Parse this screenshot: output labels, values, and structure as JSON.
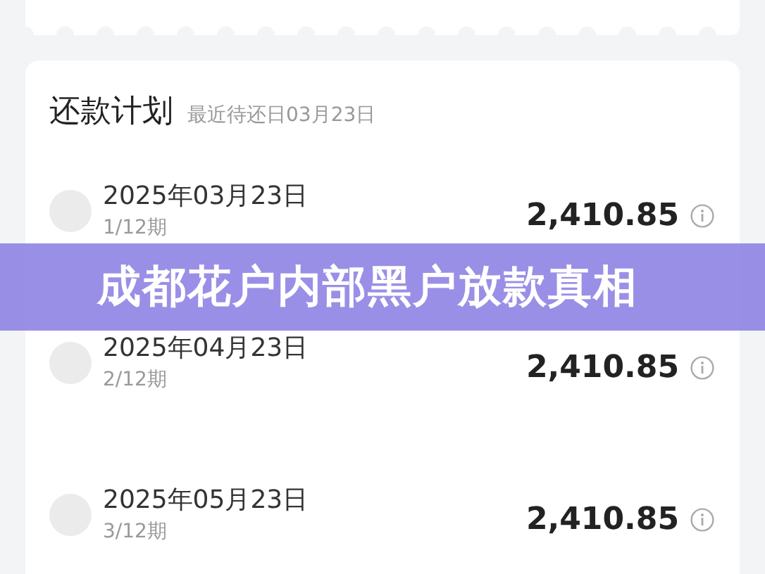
{
  "plan": {
    "title": "还款计划",
    "subtitle": "最近待还日03月23日",
    "installments": [
      {
        "date": "2025年03月23日",
        "period": "1/12期",
        "amount": "2,410.85"
      },
      {
        "date": "2025年04月23日",
        "period": "2/12期",
        "amount": "2,410.85"
      },
      {
        "date": "2025年05月23日",
        "period": "3/12期",
        "amount": "2,410.85"
      }
    ]
  },
  "banner": {
    "title": "成都花户内部黑户放款真相"
  }
}
